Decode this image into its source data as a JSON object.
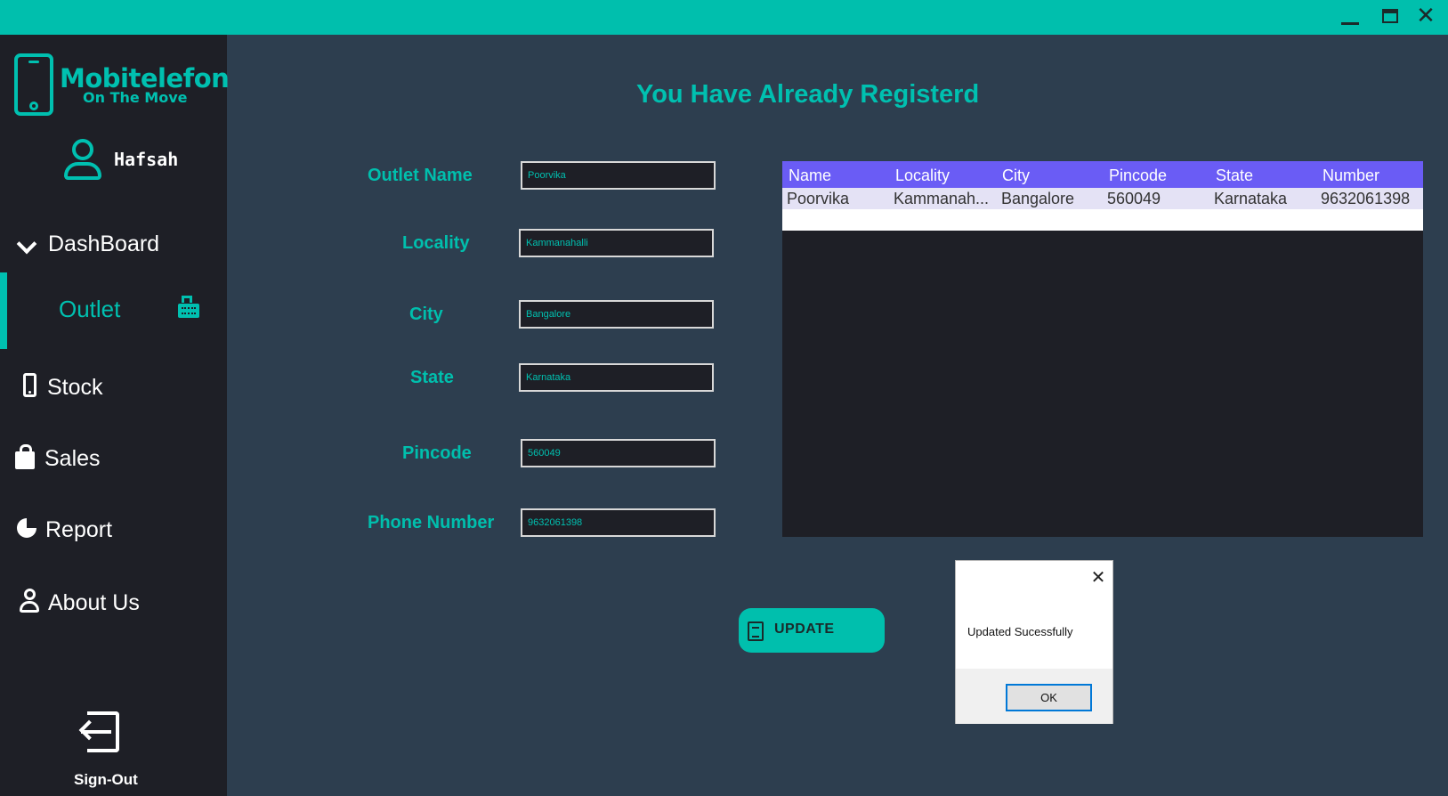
{
  "window": {
    "close_glyph": "✕"
  },
  "sidebar": {
    "logo": {
      "title": "Mobitelefon",
      "subtitle": "On The Move",
      "icon": "phone-icon"
    },
    "user": {
      "name": "Hafsah",
      "icon": "user-icon"
    },
    "items": [
      {
        "label": "DashBoard",
        "icon": "chevron-down-icon"
      },
      {
        "label": "Outlet",
        "icon": "cash-register-icon",
        "active": true
      },
      {
        "label": "Stock",
        "icon": "mobile-icon"
      },
      {
        "label": "Sales",
        "icon": "shopping-bag-icon"
      },
      {
        "label": "Report",
        "icon": "pie-chart-icon"
      },
      {
        "label": "About Us",
        "icon": "person-icon"
      }
    ],
    "signout": {
      "label": "Sign-Out",
      "icon": "sign-out-icon"
    }
  },
  "main": {
    "title": "You Have Already Registerd",
    "form": {
      "outlet_name": {
        "label": "Outlet Name",
        "value": "Poorvika"
      },
      "locality": {
        "label": "Locality",
        "value": "Kammanahalli"
      },
      "city": {
        "label": "City",
        "value": "Bangalore"
      },
      "state": {
        "label": "State",
        "value": "Karnataka"
      },
      "pincode": {
        "label": "Pincode",
        "value": "560049"
      },
      "phone": {
        "label": "Phone Number",
        "value": "9632061398"
      }
    },
    "table": {
      "columns": [
        "Name",
        "Locality",
        "City",
        "Pincode",
        "State",
        "Number"
      ],
      "rows": [
        [
          "Poorvika",
          "Kammanah...",
          "Bangalore",
          "560049",
          "Karnataka",
          "9632061398"
        ]
      ]
    },
    "update_button": {
      "label": "UPDATE",
      "icon": "edit-note-icon"
    }
  },
  "dialog": {
    "message": "Updated Sucessfully",
    "ok_label": "OK",
    "close_glyph": "✕"
  },
  "colors": {
    "accent": "#00bfad",
    "sidebar_bg": "#1e1f26",
    "content_bg": "#2d3e4f",
    "table_header": "#6a5cf5"
  }
}
